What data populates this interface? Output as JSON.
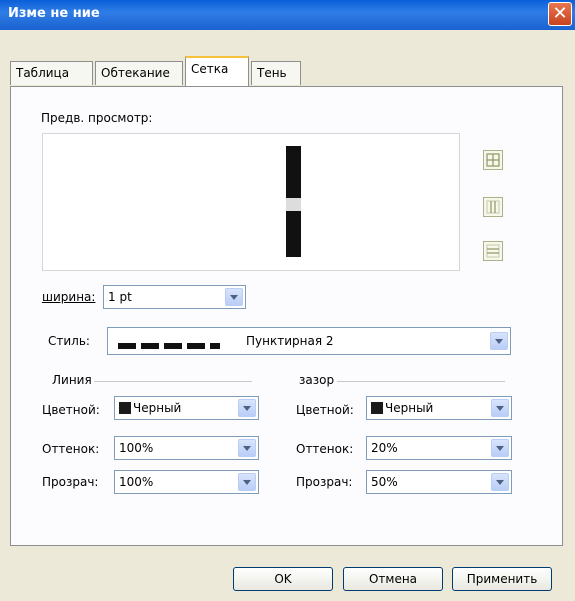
{
  "window": {
    "title": "Изме не ние"
  },
  "tabs": [
    {
      "label": "Таблица"
    },
    {
      "label": "Обтекание"
    },
    {
      "label": "Сетка"
    },
    {
      "label": "Тень"
    }
  ],
  "preview": {
    "label": "Предв. просмотр:"
  },
  "width_field": {
    "label": "ширина:",
    "value": "1 pt"
  },
  "style_field": {
    "label": "Стиль:",
    "value": "Пунктирная 2"
  },
  "line_group": {
    "title": "Линия",
    "color_label": "Цветной:",
    "color_value": "Черный",
    "tint_label": "Оттенок:",
    "tint_value": "100%",
    "transparency_label": "Прозрач:",
    "transparency_value": "100%"
  },
  "gap_group": {
    "title": "зазор",
    "color_label": "Цветной:",
    "color_value": "Черный",
    "tint_label": "Оттенок:",
    "tint_value": "20%",
    "transparency_label": "Прозрач:",
    "transparency_value": "50%"
  },
  "buttons": {
    "ok": "OK",
    "cancel": "Отмена",
    "apply": "Применить"
  },
  "colors": {
    "titlebar": "#1b62d0",
    "dialog_bg": "#ece9d8",
    "line_color": "#1a1a1a",
    "active_tab_highlight": "#f6c13b"
  }
}
